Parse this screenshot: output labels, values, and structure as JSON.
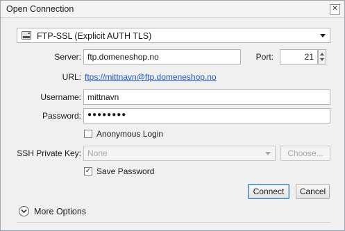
{
  "window": {
    "title": "Open Connection"
  },
  "protocol": {
    "selected": "FTP-SSL (Explicit AUTH TLS)"
  },
  "server": {
    "label": "Server:",
    "value": "ftp.domeneshop.no"
  },
  "port": {
    "label": "Port:",
    "value": "21"
  },
  "url": {
    "label": "URL:",
    "value": "ftps://mittnavn@ftp.domeneshop.no"
  },
  "username": {
    "label": "Username:",
    "value": "mittnavn"
  },
  "password": {
    "label": "Password:",
    "value": "●●●●●●●●"
  },
  "anonymous_login": {
    "label": "Anonymous Login",
    "checked": false
  },
  "ssh_key": {
    "label": "SSH Private Key:",
    "value": "None",
    "choose_label": "Choose..."
  },
  "save_password": {
    "label": "Save Password",
    "checked": true
  },
  "buttons": {
    "connect": "Connect",
    "cancel": "Cancel"
  },
  "more_options": {
    "label": "More Options"
  },
  "icons": {
    "close": "close-icon",
    "protocol": "drive-icon",
    "expand": "chevron-down-icon"
  }
}
